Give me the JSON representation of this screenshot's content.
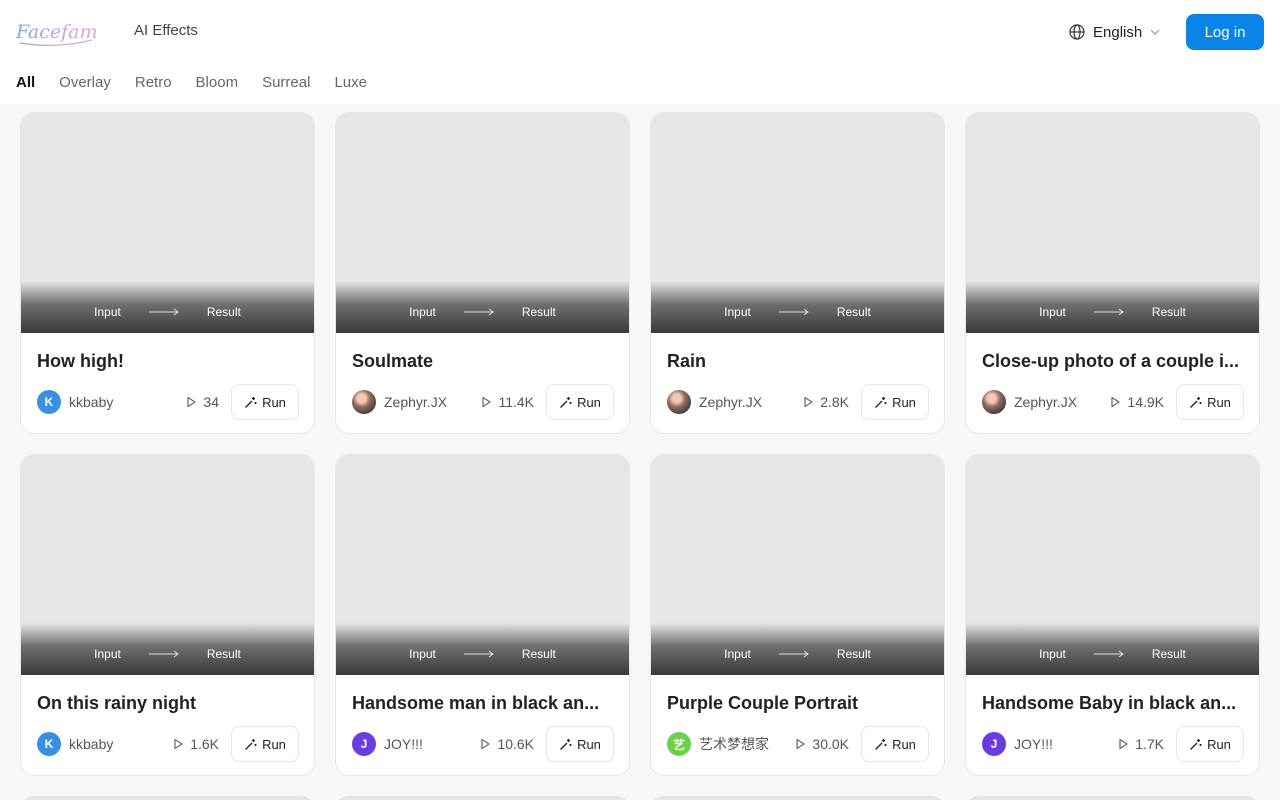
{
  "header": {
    "logo_text": "Facefame",
    "nav_link": "AI Effects",
    "language": "English",
    "login_label": "Log in",
    "accent": "#0a84e6"
  },
  "tabs": [
    "All",
    "Overlay",
    "Retro",
    "Bloom",
    "Surreal",
    "Luxe"
  ],
  "thumb_labels": {
    "input": "Input",
    "result": "Result"
  },
  "run_label": "Run",
  "cards": [
    {
      "title": "How high!",
      "author": "kkbaby",
      "avatar_letter": "K",
      "avatar_color": "#3a8fe0",
      "runs": "34"
    },
    {
      "title": "Soulmate",
      "author": "Zephyr.JX",
      "avatar_letter": "",
      "avatar_color": "photo",
      "runs": "11.4K"
    },
    {
      "title": "Rain",
      "author": "Zephyr.JX",
      "avatar_letter": "",
      "avatar_color": "photo",
      "runs": "2.8K"
    },
    {
      "title": "Close-up photo of a couple i...",
      "author": "Zephyr.JX",
      "avatar_letter": "",
      "avatar_color": "photo",
      "runs": "14.9K"
    },
    {
      "title": "On this rainy night",
      "author": "kkbaby",
      "avatar_letter": "K",
      "avatar_color": "#3a8fe0",
      "runs": "1.6K"
    },
    {
      "title": "Handsome man in black an...",
      "author": "JOY!!!",
      "avatar_letter": "J",
      "avatar_color": "#6a3de0",
      "runs": "10.6K"
    },
    {
      "title": "Purple Couple Portrait",
      "author": "艺术梦想家",
      "avatar_letter": "艺",
      "avatar_color": "#6cd14a",
      "runs": "30.0K"
    },
    {
      "title": "Handsome Baby in black an...",
      "author": "JOY!!!",
      "avatar_letter": "J",
      "avatar_color": "#6a3de0",
      "runs": "1.7K"
    }
  ]
}
